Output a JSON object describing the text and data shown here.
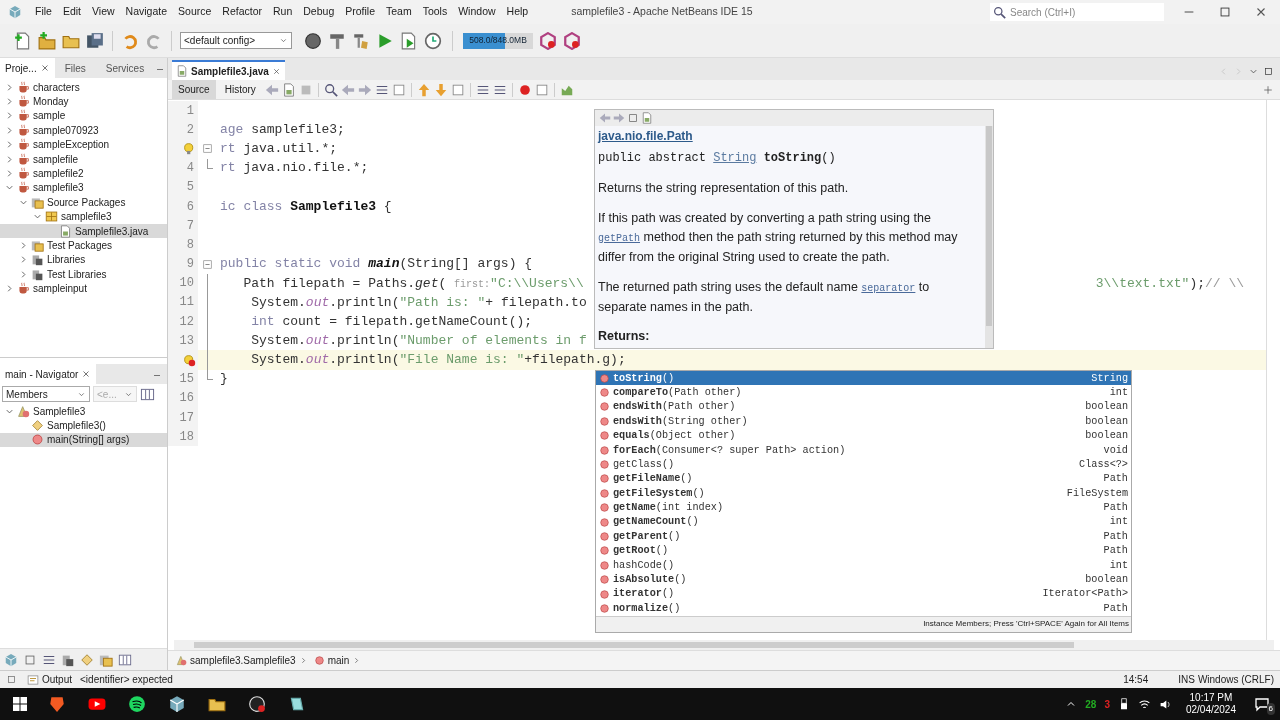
{
  "menu_bar": {
    "items": [
      "File",
      "Edit",
      "View",
      "Navigate",
      "Source",
      "Refactor",
      "Run",
      "Debug",
      "Profile",
      "Team",
      "Tools",
      "Window",
      "Help"
    ],
    "title": "samplefile3 - Apache NetBeans IDE 15",
    "search": {
      "placeholder": "Search (Ctrl+I)"
    }
  },
  "toolbar": {
    "config": "<default config>",
    "memory": {
      "reading": "508.0/848.0MB",
      "level": 0.6
    }
  },
  "projects_panel": {
    "tabs": [
      {
        "label": "Proje...",
        "selected": true
      },
      {
        "label": "Files",
        "selected": false
      },
      {
        "label": "Services",
        "selected": false
      }
    ],
    "tree": [
      {
        "label": "characters",
        "kind": "project",
        "expanded": false,
        "selected": false
      },
      {
        "label": "Monday",
        "kind": "project",
        "expanded": false,
        "selected": false
      },
      {
        "label": "sample",
        "kind": "project",
        "expanded": false,
        "selected": false
      },
      {
        "label": "sample070923",
        "kind": "project",
        "expanded": false,
        "selected": false
      },
      {
        "label": "sampleException",
        "kind": "project",
        "expanded": false,
        "selected": false
      },
      {
        "label": "samplefile",
        "kind": "project",
        "expanded": false,
        "selected": false
      },
      {
        "label": "samplefile2",
        "kind": "project",
        "expanded": false,
        "selected": false
      },
      {
        "label": "samplefile3",
        "kind": "project",
        "expanded": true,
        "selected": false,
        "children": [
          {
            "label": "Source Packages",
            "kind": "packages",
            "expanded": true,
            "selected": false,
            "children": [
              {
                "label": "samplefile3",
                "kind": "package",
                "expanded": true,
                "selected": false,
                "children": [
                  {
                    "label": "Samplefile3.java",
                    "kind": "java_file",
                    "selected": true
                  }
                ]
              }
            ]
          },
          {
            "label": "Test Packages",
            "kind": "packages",
            "expanded": false,
            "selected": false
          },
          {
            "label": "Libraries",
            "kind": "libraries",
            "expanded": false,
            "selected": false
          },
          {
            "label": "Test Libraries",
            "kind": "libraries",
            "expanded": false,
            "selected": false
          }
        ]
      },
      {
        "label": "sampleinput",
        "kind": "project",
        "expanded": false,
        "selected": false
      }
    ]
  },
  "navigator": {
    "title": "main - Navigator",
    "filter": "Members",
    "second_filter": "<e...",
    "tree": [
      {
        "label": "Samplefile3",
        "kind": "class",
        "expanded": true,
        "selected": false,
        "children": [
          {
            "label": "Samplefile3()",
            "kind": "constructor",
            "selected": false
          },
          {
            "label": "main(String[] args)",
            "kind": "method",
            "selected": true
          }
        ]
      }
    ]
  },
  "editor": {
    "tab": "Samplefile3.java",
    "views": [
      {
        "label": "Source",
        "selected": true
      },
      {
        "label": "History",
        "selected": false
      }
    ],
    "lines": [
      {
        "kind": "number",
        "number": "1",
        "fold_start": false,
        "in_fold": false,
        "fold_end": false,
        "current": false
      },
      {
        "kind": "number",
        "number": "2",
        "fold_start": false,
        "in_fold": false,
        "fold_end": false,
        "current": false,
        "segments": [
          {
            "text": "age",
            "kind": "keyword"
          },
          {
            "text": " samplefile3;",
            "kind": "plain"
          }
        ]
      },
      {
        "kind": "hint",
        "fold_start": true,
        "in_fold": false,
        "fold_end": false,
        "current": false,
        "segments": [
          {
            "text": "rt",
            "kind": "keyword"
          },
          {
            "text": " java.util.*;",
            "kind": "plain"
          }
        ]
      },
      {
        "kind": "number",
        "number": "4",
        "fold_start": false,
        "in_fold": false,
        "fold_end": true,
        "current": false,
        "segments": [
          {
            "text": "rt",
            "kind": "keyword"
          },
          {
            "text": " java.nio.file.*;",
            "kind": "plain"
          }
        ]
      },
      {
        "kind": "number",
        "number": "5",
        "fold_start": false,
        "in_fold": false,
        "fold_end": false,
        "current": false
      },
      {
        "kind": "number",
        "number": "6",
        "fold_start": false,
        "in_fold": false,
        "fold_end": false,
        "current": false,
        "segments": [
          {
            "text": "ic class ",
            "kind": "keyword"
          },
          {
            "text": "Samplefile3",
            "kind": "bold"
          },
          {
            "text": " {",
            "kind": "plain"
          }
        ]
      },
      {
        "kind": "number",
        "number": "7",
        "fold_start": false,
        "in_fold": false,
        "fold_end": false,
        "current": false
      },
      {
        "kind": "number",
        "number": "8",
        "fold_start": false,
        "in_fold": false,
        "fold_end": false,
        "current": false
      },
      {
        "kind": "number",
        "number": "9",
        "fold_start": true,
        "in_fold": false,
        "fold_end": false,
        "current": false,
        "segments": [
          {
            "text": "public static void ",
            "kind": "keyword"
          },
          {
            "text": "main",
            "kind": "bold_italic"
          },
          {
            "text": "(String[] args) {",
            "kind": "plain"
          }
        ]
      },
      {
        "kind": "number",
        "number": "10",
        "fold_start": false,
        "in_fold": true,
        "fold_end": false,
        "current": false,
        "segments": [
          {
            "text": "   Path filepath = Paths.",
            "kind": "plain"
          },
          {
            "text": "get",
            "kind": "italic"
          },
          {
            "text": "( ",
            "kind": "plain"
          },
          {
            "text": "first:",
            "kind": "hint"
          },
          {
            "text": "\"C:\\\\Users\\\\",
            "kind": "string"
          }
        ],
        "tail": [
          {
            "text": "3\\\\text.txt\"",
            "kind": "string"
          },
          {
            "text": ");",
            "kind": "plain"
          },
          {
            "text": "// \\\\",
            "kind": "comment"
          }
        ]
      },
      {
        "kind": "number",
        "number": "11",
        "fold_start": false,
        "in_fold": true,
        "fold_end": false,
        "current": false,
        "segments": [
          {
            "text": "    System.",
            "kind": "plain"
          },
          {
            "text": "out",
            "kind": "field"
          },
          {
            "text": ".println(",
            "kind": "plain"
          },
          {
            "text": "\"Path is: \"",
            "kind": "string"
          },
          {
            "text": "+ filepath.to",
            "kind": "plain"
          }
        ]
      },
      {
        "kind": "number",
        "number": "12",
        "fold_start": false,
        "in_fold": true,
        "fold_end": false,
        "current": false,
        "segments": [
          {
            "text": "    int",
            "kind": "keyword"
          },
          {
            "text": " count = filepath.getNameCount();",
            "kind": "plain"
          }
        ]
      },
      {
        "kind": "number",
        "number": "13",
        "fold_start": false,
        "in_fold": true,
        "fold_end": false,
        "current": false,
        "segments": [
          {
            "text": "    System.",
            "kind": "plain"
          },
          {
            "text": "out",
            "kind": "field"
          },
          {
            "text": ".println(",
            "kind": "plain"
          },
          {
            "text": "\"Number of elements in f",
            "kind": "string"
          }
        ]
      },
      {
        "kind": "error",
        "fold_start": false,
        "in_fold": true,
        "fold_end": false,
        "current": true,
        "segments": [
          {
            "text": "    System.",
            "kind": "plain"
          },
          {
            "text": "out",
            "kind": "field"
          },
          {
            "text": ".println(",
            "kind": "plain"
          },
          {
            "text": "\"File Name is: \"",
            "kind": "string"
          },
          {
            "text": "+filepath.g);",
            "kind": "plain"
          }
        ]
      },
      {
        "kind": "number",
        "number": "15",
        "fold_start": false,
        "in_fold": false,
        "fold_end": true,
        "current": false,
        "segments": [
          {
            "text": "}",
            "kind": "plain"
          }
        ]
      },
      {
        "kind": "number",
        "number": "16",
        "fold_start": false,
        "in_fold": false,
        "fold_end": false,
        "current": false
      },
      {
        "kind": "number",
        "number": "17",
        "fold_start": false,
        "in_fold": false,
        "fold_end": false,
        "current": false
      },
      {
        "kind": "number",
        "number": "18",
        "fold_start": false,
        "in_fold": false,
        "fold_end": false,
        "current": false
      }
    ],
    "breadcrumbs": [
      "samplefile3.Samplefile3",
      "main"
    ]
  },
  "doc_popup": {
    "class_link": "java.nio.file.Path",
    "signature": [
      {
        "text": "public abstract ",
        "kind": "text"
      },
      {
        "text": "String",
        "kind": "link"
      },
      {
        "text": " toString",
        "kind": "bold"
      },
      {
        "text": "()",
        "kind": "text"
      }
    ],
    "paragraphs": [
      [
        {
          "text": "Returns the string representation of this path.",
          "kind": "text"
        }
      ],
      [
        {
          "text": "If this path was created by converting a path string using the ",
          "kind": "text"
        },
        {
          "text": "getPath",
          "kind": "link"
        },
        {
          "text": " method then the path string returned by this method may differ from the original String used to create the path.",
          "kind": "text"
        }
      ],
      [
        {
          "text": "The returned path string uses the default name ",
          "kind": "text"
        },
        {
          "text": "separator",
          "kind": "link"
        },
        {
          "text": " to separate names in the path.",
          "kind": "text"
        }
      ]
    ],
    "returns": "Returns:"
  },
  "completion": {
    "items": [
      {
        "text": "**toString**()",
        "type": "String",
        "selected": true
      },
      {
        "text": "**compareTo**(Path other)",
        "type": "int",
        "selected": false
      },
      {
        "text": "**endsWith**(Path other)",
        "type": "boolean",
        "selected": false
      },
      {
        "text": "**endsWith**(String other)",
        "type": "boolean",
        "selected": false
      },
      {
        "text": "**equals**(Object other)",
        "type": "boolean",
        "selected": false
      },
      {
        "text": "**forEach**(Consumer<? super Path> action)",
        "type": "void",
        "selected": false
      },
      {
        "text": "getClass()",
        "type": "Class<?>",
        "selected": false
      },
      {
        "text": "**getFileName**()",
        "type": "Path",
        "selected": false
      },
      {
        "text": "**getFileSystem**()",
        "type": "FileSystem",
        "selected": false
      },
      {
        "text": "**getName**(int index)",
        "type": "Path",
        "selected": false
      },
      {
        "text": "**getNameCount**()",
        "type": "int",
        "selected": false
      },
      {
        "text": "**getParent**()",
        "type": "Path",
        "selected": false
      },
      {
        "text": "**getRoot**()",
        "type": "Path",
        "selected": false
      },
      {
        "text": "hashCode()",
        "type": "int",
        "selected": false
      },
      {
        "text": "**isAbsolute**()",
        "type": "boolean",
        "selected": false
      },
      {
        "text": "**iterator**()",
        "type": "Iterator<Path>",
        "selected": false
      },
      {
        "text": "**normalize**()",
        "type": "Path",
        "selected": false
      }
    ],
    "footer": "Instance Members; Press 'Ctrl+SPACE' Again for All Items"
  },
  "status_bar": {
    "output_tab": "Output",
    "message": "<identifier> expected",
    "position": "14:54",
    "mode": "INS",
    "line_ending": "Windows (CRLF)"
  },
  "taskbar": {
    "tray": [
      {
        "text": "28",
        "color": "#22aa22"
      },
      {
        "text": "3",
        "color": "#dd2222"
      }
    ],
    "time": "10:17 PM",
    "date": "02/04/2024",
    "notifications": "6"
  }
}
